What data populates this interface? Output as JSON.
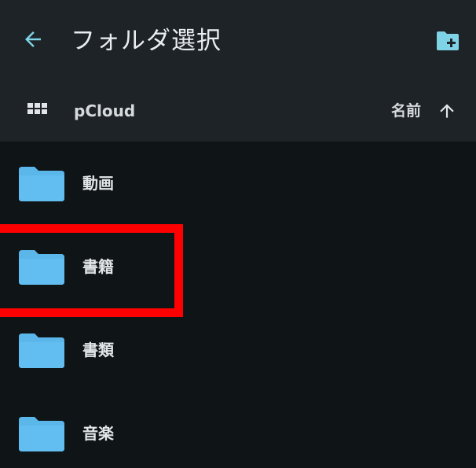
{
  "header": {
    "title": "フォルダ選択",
    "back_icon": "arrow-left-icon",
    "new_folder_icon": "folder-plus-icon"
  },
  "toolbar": {
    "view_icon": "grid-view-icon",
    "location": "pCloud",
    "sort_label": "名前",
    "sort_direction_icon": "arrow-up-icon"
  },
  "folders": [
    {
      "name": "動画",
      "icon": "folder-icon"
    },
    {
      "name": "書籍",
      "icon": "folder-icon",
      "highlighted": true
    },
    {
      "name": "書類",
      "icon": "folder-icon"
    },
    {
      "name": "音楽",
      "icon": "folder-icon"
    }
  ],
  "colors": {
    "accent": "#7fd3e6",
    "folder": "#5bb6ea",
    "toolbar_bg": "#1d2326",
    "list_bg": "#0f1417",
    "highlight": "#ff0000"
  }
}
